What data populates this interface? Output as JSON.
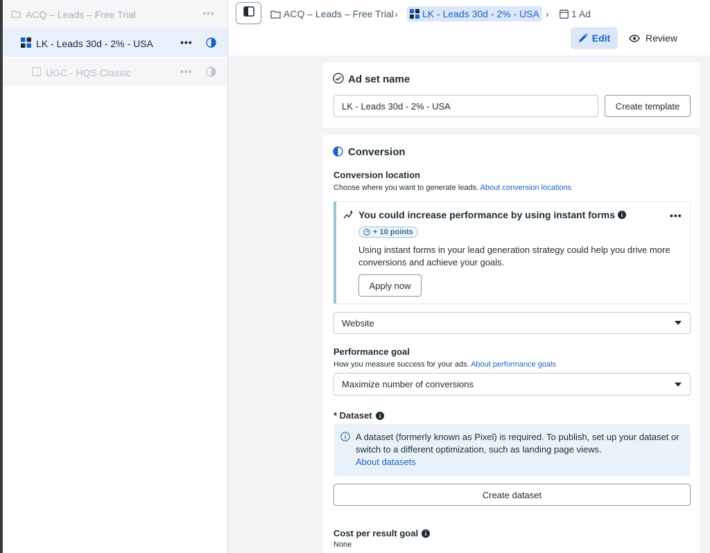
{
  "sidebar": {
    "campaign": {
      "label": "ACQ – Leads – Free Trial",
      "menu": "•••"
    },
    "adset": {
      "label": "LK - Leads 30d - 2% - USA",
      "menu": "•••"
    },
    "ad": {
      "label": "UGC - HQS Classic",
      "menu": "•••"
    }
  },
  "breadcrumb": {
    "campaign": "ACQ – Leads – Free Trial",
    "adset": "LK - Leads 30d - 2% - USA",
    "ads": "1 Ad"
  },
  "header": {
    "edit_label": "Edit",
    "review_label": "Review"
  },
  "adset_name": {
    "title": "Ad set name",
    "value": "LK - Leads 30d - 2% - USA",
    "create_template_label": "Create template"
  },
  "conversion": {
    "title": "Conversion",
    "location_label": "Conversion location",
    "location_help": "Choose where you want to generate leads.",
    "location_link": "About conversion locations",
    "recommendation": {
      "title": "You could increase performance by using instant forms",
      "menu": "•••",
      "points": "+ 10 points",
      "body": "Using instant forms in your lead generation strategy could help you drive more conversions and achieve your goals.",
      "apply_label": "Apply now"
    },
    "location_value": "Website",
    "performance_goal_label": "Performance goal",
    "performance_goal_help": "How you measure success for your ads.",
    "performance_goal_link": "About performance goals",
    "performance_goal_value": "Maximize number of conversions",
    "dataset_label": "* Dataset",
    "dataset_info": "A dataset (formerly known as Pixel) is required. To publish, set up your dataset or switch to a different optimization, such as landing page views.",
    "dataset_link": "About datasets",
    "create_dataset_label": "Create dataset",
    "cost_goal_label": "Cost per result goal",
    "cost_goal_value": "None"
  },
  "colors": {
    "accent": "#1b61c9",
    "selected_bg": "#e7f0fb",
    "info_bg": "#e9f2fb"
  }
}
